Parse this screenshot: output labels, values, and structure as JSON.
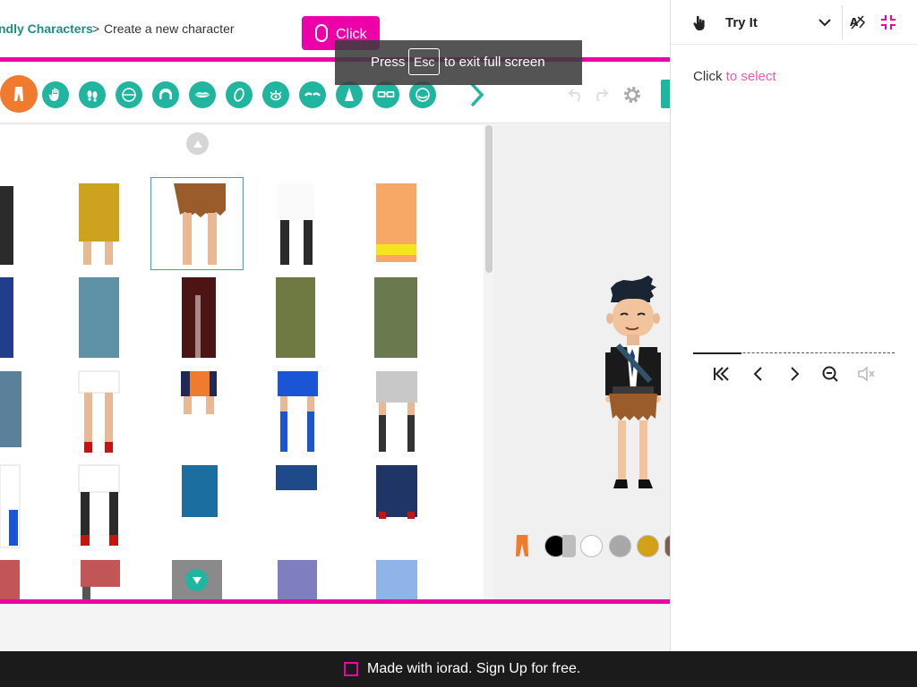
{
  "breadcrumb": {
    "link": "ndly Characters",
    "separator": ">",
    "current": "Create a new character"
  },
  "click_badge": "Click",
  "tooltip": {
    "pre": "Press",
    "key": "Esc",
    "post": "to exit full screen"
  },
  "toolbar": {
    "tools": [
      "pants-icon",
      "hand-icon",
      "feet-icon",
      "face-icon",
      "hair-icon",
      "mouth-icon",
      "ear-icon",
      "eyes-icon",
      "eyebrows-icon",
      "nose-icon",
      "glasses-icon",
      "beard-icon"
    ]
  },
  "panel": {
    "title": "Try It",
    "instruction_pre": "Click",
    "instruction_link": "to select"
  },
  "swatches": [
    "#000000",
    "#ffffff",
    "#a8a8a8",
    "#d4a017",
    "#7a5f52"
  ],
  "footer": "Made with iorad. Sign Up for free."
}
